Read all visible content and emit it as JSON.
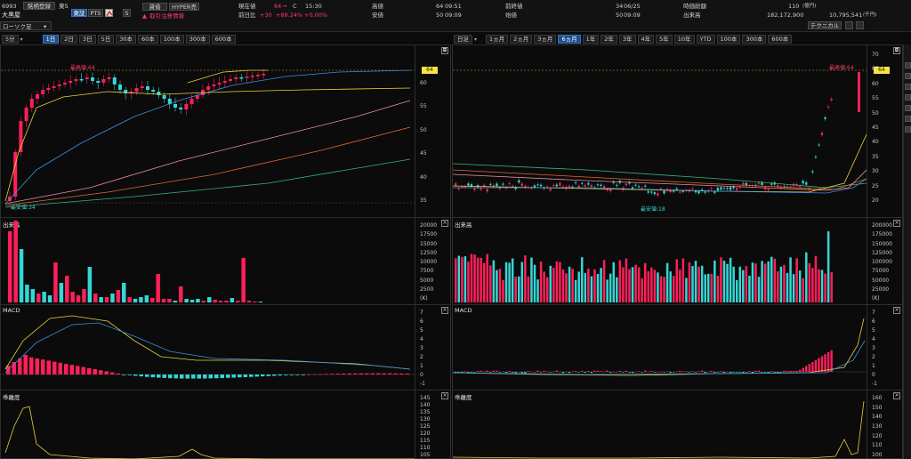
{
  "header": {
    "code": "6993",
    "name": "大黒屋",
    "favorite_btn": "銘柄登録",
    "market": "東S",
    "exchange_btn": "東証",
    "pts_btn": "PTS",
    "mode_select": "ローソク足",
    "credit_btn": "貸借",
    "hyper_btn": "HYPER売",
    "alert_text": "取引注意情報",
    "s_btn": "S",
    "quote": {
      "price_label": "現在値",
      "price_value": "64",
      "price_flag": "C",
      "price_time": "15:30",
      "change_label": "前日比",
      "change_value": "+30",
      "change_pct": "+88.24%",
      "change_pts": "+0.00%",
      "high_label": "高値",
      "high_value": "64",
      "high_time": "09:51",
      "low_label": "安値",
      "low_value": "50",
      "low_time": "09:09",
      "prev_label": "前終値",
      "prev_value": "34",
      "prev_date": "06/25",
      "open_label": "始値",
      "open_value": "50",
      "open_time": "09:09",
      "mcap_label": "時価総額",
      "mcap_value": "110",
      "mcap_unit": "(億円)",
      "volume_label": "出来高",
      "volume_value": "182,172,900",
      "turnover_value": "10,795,541",
      "turnover_unit": "(千円)",
      "technical_btn": "テクニカル"
    }
  },
  "left_chart": {
    "interval": "5分",
    "periods": [
      "1日",
      "2日",
      "3日",
      "5日",
      "30本",
      "60本",
      "100本",
      "300本",
      "600本"
    ],
    "selected_period": "1日",
    "price_tag": "64",
    "high_annotation": "最高値:64",
    "low_annotation": "最安値:34",
    "price_ticks": [
      "60",
      "55",
      "50",
      "45",
      "40",
      "35"
    ],
    "volume_label": "出来高",
    "volume_ticks": [
      "20000",
      "17500",
      "15000",
      "12500",
      "10000",
      "7500",
      "5000",
      "2500",
      "(K)"
    ],
    "macd_label": "MACD",
    "macd_ticks": [
      "7",
      "6",
      "5",
      "4",
      "3",
      "2",
      "1",
      "0",
      "-1"
    ],
    "rsi_label": "乖離度",
    "rsi_ticks": [
      "145",
      "140",
      "135",
      "130",
      "125",
      "120",
      "115",
      "110",
      "105"
    ]
  },
  "right_chart": {
    "interval": "日足",
    "periods": [
      "1ヵ月",
      "2ヵ月",
      "3ヵ月",
      "6ヵ月",
      "1年",
      "2年",
      "3年",
      "4年",
      "5年",
      "10年",
      "YTD",
      "100本",
      "300本",
      "600本"
    ],
    "selected_period": "6ヵ月",
    "price_tag": "64",
    "high_annotation": "最高値:64",
    "low_annotation": "最安値:18",
    "price_ticks": [
      "70",
      "65",
      "60",
      "55",
      "50",
      "45",
      "40",
      "35",
      "30",
      "25",
      "20"
    ],
    "volume_label": "出来高",
    "volume_ticks": [
      "200000",
      "175000",
      "150000",
      "125000",
      "100000",
      "75000",
      "50000",
      "25000",
      "(K)"
    ],
    "macd_label": "MACD",
    "macd_ticks": [
      "7",
      "6",
      "5",
      "4",
      "3",
      "2",
      "1",
      "0",
      "-1"
    ],
    "rsi_label": "乖離度",
    "rsi_ticks": [
      "160",
      "150",
      "140",
      "130",
      "120",
      "110",
      "100"
    ]
  },
  "colors": {
    "up": "#ff1f5a",
    "down": "#35d6d6",
    "ma_short": "#e8d23a",
    "ma_mid": "#3d8fe0",
    "ma_long": "#f08aa8",
    "ma_xlong": "#e06a2a",
    "ma_xxlong": "#3bb37a",
    "tag": "#f5e642"
  }
}
